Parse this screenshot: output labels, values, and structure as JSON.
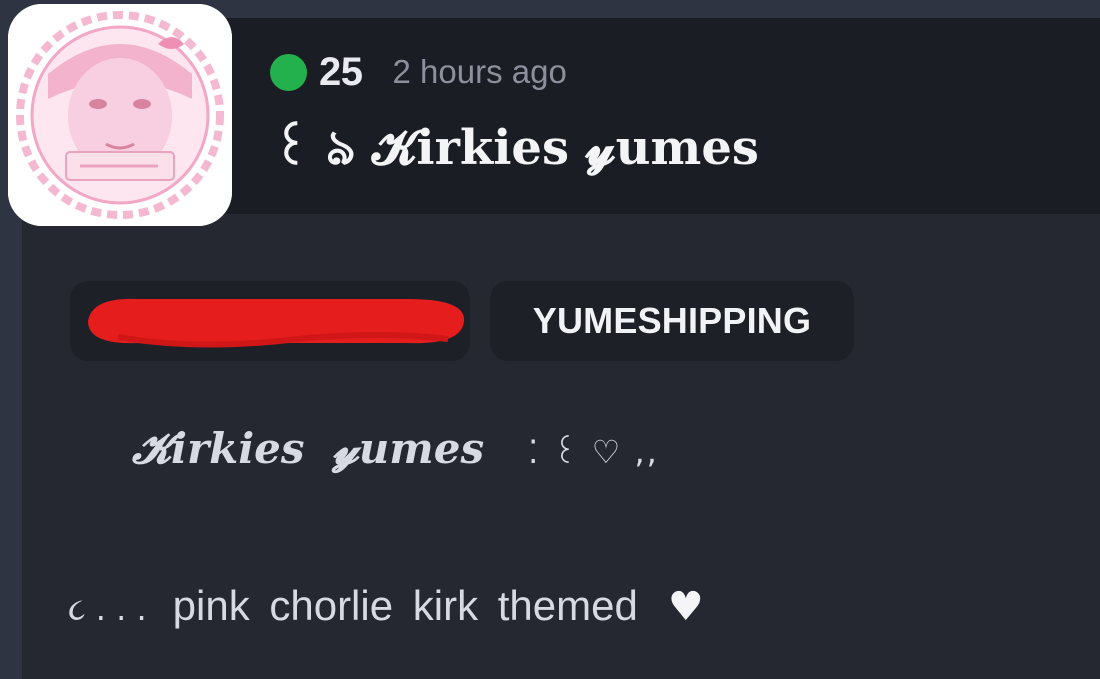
{
  "community": {
    "member_count": "25",
    "time_ago": "2 hours ago",
    "title": "꒰ ঌ 𝓚irkies 𝔂umes"
  },
  "tags": {
    "redacted_tag": "",
    "tag_1": "YUMESHIPPING"
  },
  "description": {
    "line_1_name_a": "𝓚irkies",
    "line_1_name_b": "𝔂umes",
    "line_1_decoration": "⁚ ꒰ ♡ ,,",
    "line_2_decoration": "૮ . . .",
    "line_2_text": "pink chorlie kirk themed",
    "line_2_heart": "♥"
  },
  "colors": {
    "background": "#2f3442",
    "card": "#252831",
    "header": "#1b1d24",
    "online": "#23b14d",
    "redaction": "#e51d1d",
    "avatar_pink": "#f2a7c6"
  },
  "icons": {
    "online_indicator": "online-dot-icon",
    "heart": "heart-icon",
    "avatar": "community-avatar"
  }
}
